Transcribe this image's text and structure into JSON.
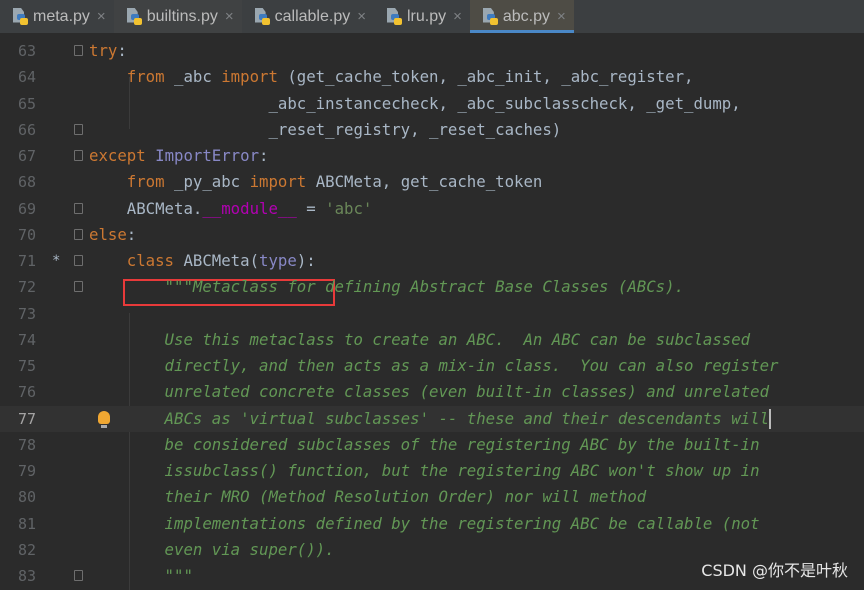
{
  "tabs": [
    {
      "label": "meta.py",
      "state": "normal"
    },
    {
      "label": "builtins.py",
      "state": "hover"
    },
    {
      "label": "callable.py",
      "state": "normal"
    },
    {
      "label": "lru.py",
      "state": "normal"
    },
    {
      "label": "abc.py",
      "state": "active"
    }
  ],
  "tab_close_glyph": "×",
  "editor": {
    "current_line": 77,
    "highlight_line": 71,
    "lines": [
      {
        "n": "63",
        "fold": "open",
        "tokens": [
          [
            "kw",
            "try"
          ],
          [
            "",
            ":"
          ]
        ]
      },
      {
        "n": "64",
        "tokens": [
          [
            "",
            "    "
          ],
          [
            "kw",
            "from"
          ],
          [
            "",
            " _abc "
          ],
          [
            "kw",
            "import"
          ],
          [
            "",
            " (get_cache_token, _abc_init, _abc_register,"
          ]
        ]
      },
      {
        "n": "65",
        "tokens": [
          [
            "",
            "                   _abc_instancecheck, _abc_subclasscheck, _get_dump,"
          ]
        ]
      },
      {
        "n": "66",
        "fold": "close",
        "tokens": [
          [
            "",
            "                   _reset_registry, _reset_caches)"
          ]
        ]
      },
      {
        "n": "67",
        "fold": "open",
        "tokens": [
          [
            "kw",
            "except"
          ],
          [
            "",
            " "
          ],
          [
            "bi",
            "ImportError"
          ],
          [
            "",
            ":"
          ]
        ]
      },
      {
        "n": "68",
        "tokens": [
          [
            "",
            "    "
          ],
          [
            "kw",
            "from"
          ],
          [
            "",
            " _py_abc "
          ],
          [
            "kw",
            "import"
          ],
          [
            "",
            " ABCMeta, get_cache_token"
          ]
        ]
      },
      {
        "n": "69",
        "fold": "close",
        "tokens": [
          [
            "",
            "    ABCMeta."
          ],
          [
            "dun",
            "__module__"
          ],
          [
            "",
            " = "
          ],
          [
            "str",
            "'abc'"
          ]
        ]
      },
      {
        "n": "70",
        "fold": "open",
        "tokens": [
          [
            "kw",
            "else"
          ],
          [
            "",
            ":"
          ]
        ]
      },
      {
        "n": "71",
        "fold": "open",
        "marker": "*",
        "tokens": [
          [
            "",
            "    "
          ],
          [
            "kw",
            "class"
          ],
          [
            "",
            " ABCMeta("
          ],
          [
            "bi",
            "type"
          ],
          [
            "",
            "):"
          ]
        ]
      },
      {
        "n": "72",
        "fold": "open",
        "tokens": [
          [
            "doc",
            "        \"\"\"Metaclass for defining Abstract Base Classes (ABCs)."
          ]
        ]
      },
      {
        "n": "73",
        "tokens": []
      },
      {
        "n": "74",
        "tokens": [
          [
            "doc",
            "        Use this metaclass to create an ABC.  An ABC can be subclassed"
          ]
        ]
      },
      {
        "n": "75",
        "tokens": [
          [
            "doc",
            "        directly, and then acts as a mix-in class.  You can also register"
          ]
        ]
      },
      {
        "n": "76",
        "tokens": [
          [
            "doc",
            "        unrelated concrete classes (even built-in classes) and unrelated"
          ]
        ]
      },
      {
        "n": "77",
        "bulb": true,
        "tokens": [
          [
            "doc",
            "        ABCs as 'virtual subclasses' -- these and their descendants will"
          ]
        ]
      },
      {
        "n": "78",
        "tokens": [
          [
            "doc",
            "        be considered subclasses of the registering ABC by the built-in"
          ]
        ]
      },
      {
        "n": "79",
        "tokens": [
          [
            "doc",
            "        issubclass() function, but the registering ABC won't show up in"
          ]
        ]
      },
      {
        "n": "80",
        "tokens": [
          [
            "doc",
            "        their MRO (Method Resolution Order) nor will method"
          ]
        ]
      },
      {
        "n": "81",
        "tokens": [
          [
            "doc",
            "        implementations defined by the registering ABC be callable (not"
          ]
        ]
      },
      {
        "n": "82",
        "tokens": [
          [
            "doc",
            "        even via super())."
          ]
        ]
      },
      {
        "n": "83",
        "fold": "close",
        "tokens": [
          [
            "doc",
            "        \"\"\""
          ]
        ]
      }
    ]
  },
  "colors": {
    "keyword": "#cc7832",
    "text": "#a9b7c6",
    "docstring": "#629755",
    "string": "#6a8759",
    "dunder": "#b200b2",
    "builtin": "#8888c6",
    "highlight_box": "#e83a3a",
    "active_tab_underline": "#4a88c7"
  },
  "watermark": "CSDN @你不是叶秋"
}
